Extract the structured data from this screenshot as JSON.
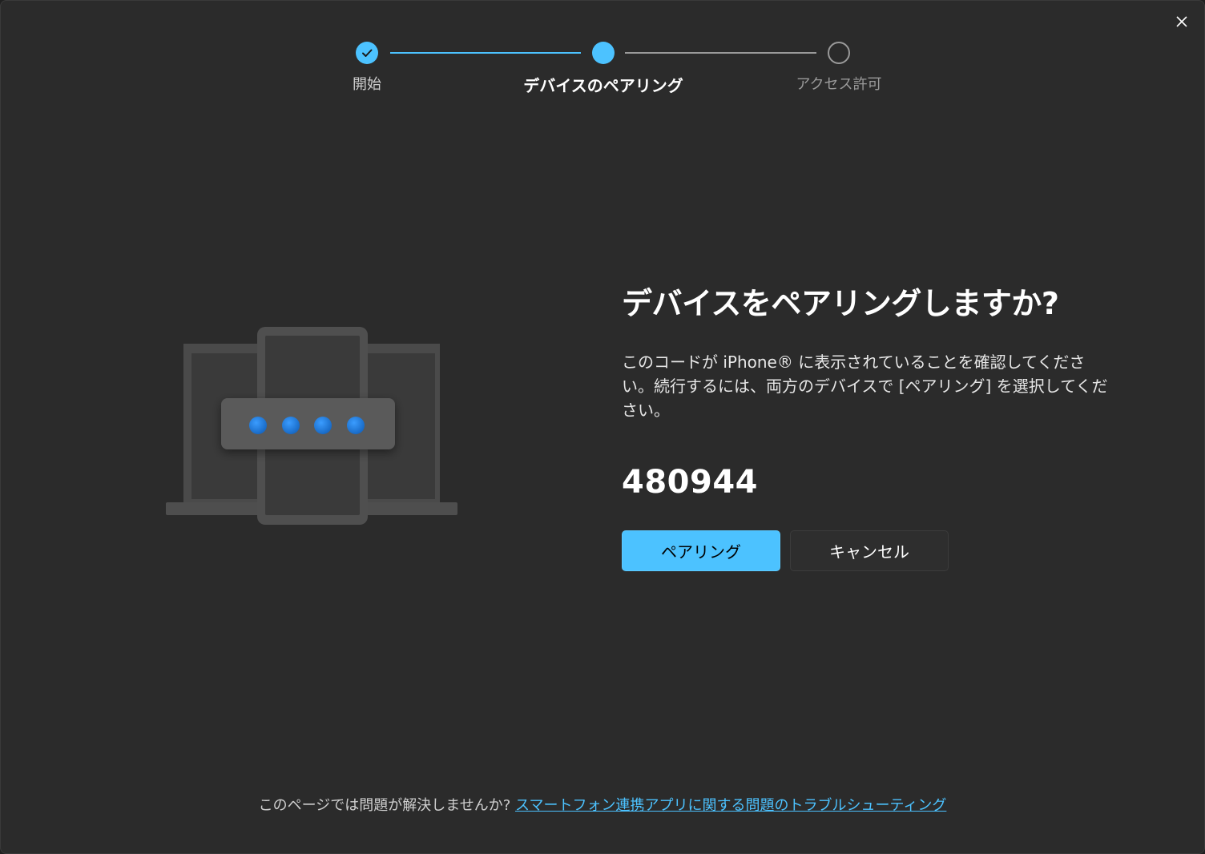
{
  "stepper": {
    "steps": [
      {
        "label": "開始",
        "state": "done"
      },
      {
        "label": "デバイスのペアリング",
        "state": "current"
      },
      {
        "label": "アクセス許可",
        "state": "pending"
      }
    ]
  },
  "dialog": {
    "title": "デバイスをペアリングしますか?",
    "description": "このコードが iPhone® に表示されていることを確認してください。続行するには、両方のデバイスで [ペアリング] を選択してください。",
    "code": "480944",
    "pair_button": "ペアリング",
    "cancel_button": "キャンセル"
  },
  "footer": {
    "question": "このページでは問題が解決しませんか? ",
    "link": "スマートフォン連携アプリに関する問題のトラブルシューティング"
  },
  "colors": {
    "accent": "#4cc2ff",
    "background": "#2b2b2b",
    "pin_dot": "#1e88e5"
  },
  "icons": {
    "close": "close-icon",
    "check": "checkmark-icon",
    "illustration": "device-pairing-illustration"
  }
}
